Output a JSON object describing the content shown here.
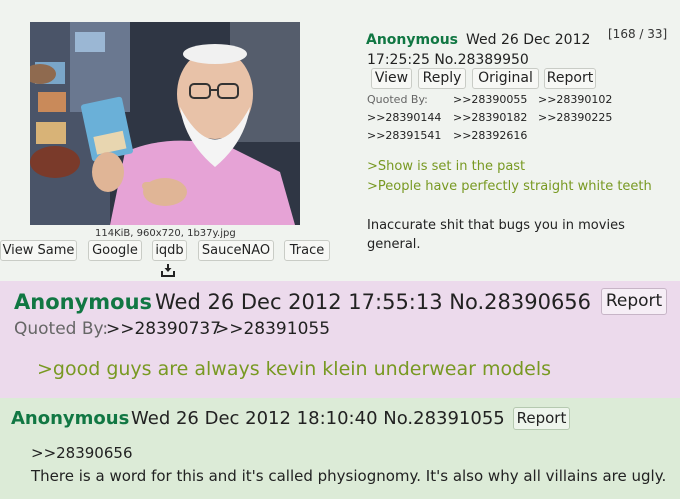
{
  "post1": {
    "name": "Anonymous",
    "date": "Wed 26 Dec 2012",
    "time_no": "17:25:25 No.28389950",
    "reply_count": "[168 / 33]",
    "buttons": [
      "View",
      "Reply",
      "Original",
      "Report"
    ],
    "quoted_by_label": "Quoted By:",
    "quoted_by": [
      ">>28390055",
      ">>28390102",
      ">>28390144",
      ">>28390182",
      ">>28390225",
      ">>28391541",
      ">>28392616"
    ],
    "greentext": [
      ">Show is set in the past",
      ">People have perfectly straight white teeth"
    ],
    "body_line1": "Inaccurate shit that bugs you in movies",
    "body_line2": "general.",
    "file_info": "114KiB, 960x720, 1b37y.jpg",
    "image_tools": [
      "View Same",
      "Google",
      "iqdb",
      "SauceNAO",
      "Trace"
    ]
  },
  "post2": {
    "name": "Anonymous",
    "meta": "Wed 26 Dec 2012 17:55:13 No.28390656",
    "report": "Report",
    "quoted_by_label": "Quoted By:",
    "quoted_by": [
      ">>28390737",
      ">>28391055"
    ],
    "greentext": ">good guys are always kevin klein underwear models"
  },
  "post3": {
    "name": "Anonymous",
    "meta": "Wed 26 Dec 2012 18:10:40 No.28391055",
    "report": "Report",
    "quote": ">>28390656",
    "body": "There is a word for this and it's called physiognomy. It's also why all villains are ugly."
  },
  "colors": {
    "name_green": "#117743",
    "greentext": "#789922",
    "post1_bg": "#f0f3ef",
    "post2_bg": "#ecdaec",
    "post3_bg": "#dcebd7"
  },
  "icons": [
    "download-icon"
  ]
}
